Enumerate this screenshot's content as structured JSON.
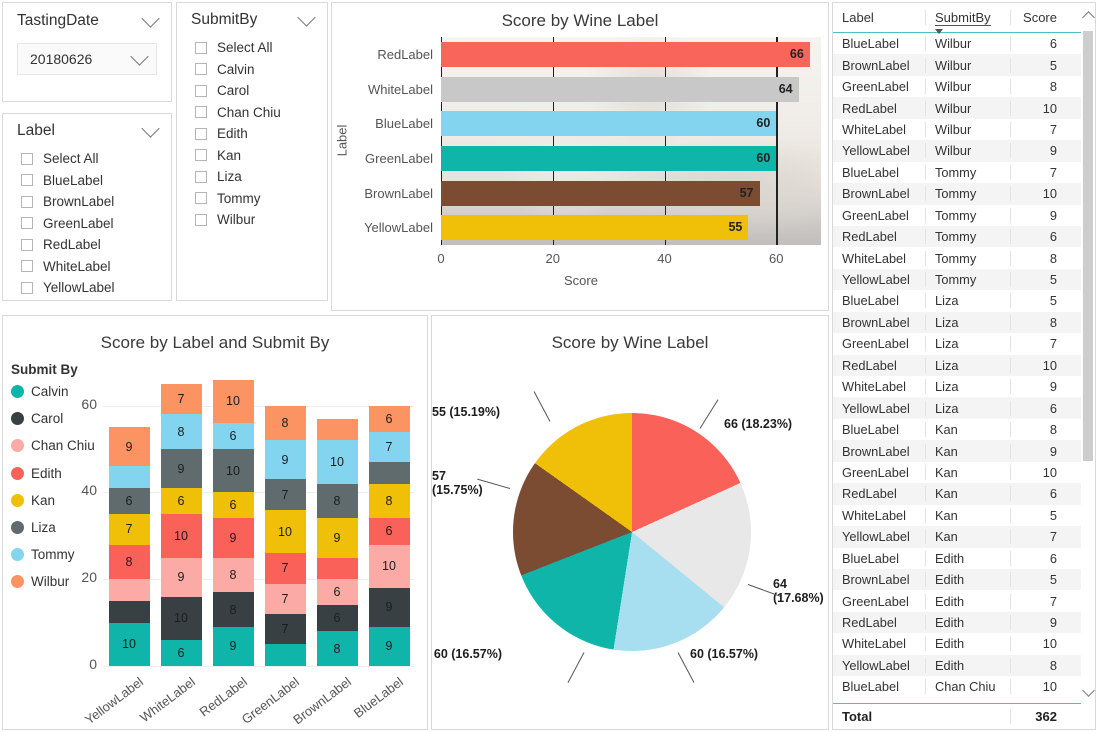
{
  "slicers": {
    "tasting_date": {
      "title": "TastingDate",
      "selected": "20180626"
    },
    "label": {
      "title": "Label",
      "items": [
        "Select All",
        "BlueLabel",
        "BrownLabel",
        "GreenLabel",
        "RedLabel",
        "WhiteLabel",
        "YellowLabel"
      ]
    },
    "submit_by": {
      "title": "SubmitBy",
      "items": [
        "Select All",
        "Calvin",
        "Carol",
        "Chan Chiu",
        "Edith",
        "Kan",
        "Liza",
        "Tommy",
        "Wilbur"
      ]
    }
  },
  "table": {
    "columns": [
      "Label",
      "SubmitBy",
      "Score"
    ],
    "sorted_column": "SubmitBy",
    "rows": [
      [
        "BlueLabel",
        "Wilbur",
        "6"
      ],
      [
        "BrownLabel",
        "Wilbur",
        "5"
      ],
      [
        "GreenLabel",
        "Wilbur",
        "8"
      ],
      [
        "RedLabel",
        "Wilbur",
        "10"
      ],
      [
        "WhiteLabel",
        "Wilbur",
        "7"
      ],
      [
        "YellowLabel",
        "Wilbur",
        "9"
      ],
      [
        "BlueLabel",
        "Tommy",
        "7"
      ],
      [
        "BrownLabel",
        "Tommy",
        "10"
      ],
      [
        "GreenLabel",
        "Tommy",
        "9"
      ],
      [
        "RedLabel",
        "Tommy",
        "6"
      ],
      [
        "WhiteLabel",
        "Tommy",
        "8"
      ],
      [
        "YellowLabel",
        "Tommy",
        "5"
      ],
      [
        "BlueLabel",
        "Liza",
        "5"
      ],
      [
        "BrownLabel",
        "Liza",
        "8"
      ],
      [
        "GreenLabel",
        "Liza",
        "7"
      ],
      [
        "RedLabel",
        "Liza",
        "10"
      ],
      [
        "WhiteLabel",
        "Liza",
        "9"
      ],
      [
        "YellowLabel",
        "Liza",
        "6"
      ],
      [
        "BlueLabel",
        "Kan",
        "8"
      ],
      [
        "BrownLabel",
        "Kan",
        "9"
      ],
      [
        "GreenLabel",
        "Kan",
        "10"
      ],
      [
        "RedLabel",
        "Kan",
        "6"
      ],
      [
        "WhiteLabel",
        "Kan",
        "5"
      ],
      [
        "YellowLabel",
        "Kan",
        "7"
      ],
      [
        "BlueLabel",
        "Edith",
        "6"
      ],
      [
        "BrownLabel",
        "Edith",
        "5"
      ],
      [
        "GreenLabel",
        "Edith",
        "7"
      ],
      [
        "RedLabel",
        "Edith",
        "9"
      ],
      [
        "WhiteLabel",
        "Edith",
        "10"
      ],
      [
        "YellowLabel",
        "Edith",
        "8"
      ],
      [
        "BlueLabel",
        "Chan Chiu",
        "10"
      ]
    ],
    "total_label": "Total",
    "total_value": "362"
  },
  "chart_data": [
    {
      "id": "hbar",
      "type": "bar",
      "orientation": "horizontal",
      "title": "Score by Wine Label",
      "xlabel": "Score",
      "ylabel": "Label",
      "xlim": [
        0,
        68
      ],
      "xticks": [
        "0",
        "20",
        "40",
        "60"
      ],
      "grid": true,
      "categories": [
        "RedLabel",
        "WhiteLabel",
        "BlueLabel",
        "GreenLabel",
        "BrownLabel",
        "YellowLabel"
      ],
      "values": [
        66,
        64,
        60,
        60,
        57,
        55
      ],
      "colors": [
        "#f9655b",
        "#c8c8c8",
        "#83d4ee",
        "#0fb5a8",
        "#7b4b32",
        "#efc007"
      ]
    },
    {
      "id": "stacked",
      "type": "bar",
      "orientation": "vertical",
      "stacked": true,
      "title": "Score by Label and Submit By",
      "legend_title": "Submit By",
      "legend_position": "left",
      "ylim": [
        0,
        68
      ],
      "yticks": [
        "0",
        "20",
        "40",
        "60"
      ],
      "categories": [
        "YellowLabel",
        "WhiteLabel",
        "RedLabel",
        "GreenLabel",
        "BrownLabel",
        "BlueLabel"
      ],
      "series": [
        {
          "name": "Calvin",
          "color": "#0fb5a8",
          "values": [
            10,
            6,
            9,
            5,
            8,
            9
          ]
        },
        {
          "name": "Carol",
          "color": "#384044",
          "values": [
            5,
            10,
            8,
            7,
            6,
            9
          ]
        },
        {
          "name": "Chan Chiu",
          "color": "#fbaaa6",
          "values": [
            5,
            9,
            8,
            7,
            6,
            10
          ]
        },
        {
          "name": "Edith",
          "color": "#fa6158",
          "values": [
            8,
            10,
            9,
            7,
            5,
            6
          ]
        },
        {
          "name": "Kan",
          "color": "#efc007",
          "values": [
            7,
            6,
            6,
            10,
            9,
            8
          ]
        },
        {
          "name": "Liza",
          "color": "#5f6b6d",
          "values": [
            6,
            9,
            10,
            7,
            8,
            5
          ]
        },
        {
          "name": "Tommy",
          "color": "#83d4ee",
          "values": [
            5,
            8,
            6,
            9,
            10,
            7
          ]
        },
        {
          "name": "Wilbur",
          "color": "#fc9362",
          "values": [
            9,
            7,
            10,
            8,
            5,
            6
          ]
        }
      ],
      "hidden_labels": [
        [
          false,
          true,
          true,
          false,
          false,
          false,
          true,
          false
        ],
        [
          false,
          false,
          false,
          false,
          false,
          false,
          false,
          false
        ],
        [
          false,
          false,
          false,
          false,
          false,
          false,
          false,
          false
        ],
        [
          true,
          false,
          false,
          false,
          false,
          false,
          false,
          false
        ],
        [
          false,
          false,
          false,
          true,
          false,
          false,
          false,
          true
        ],
        [
          false,
          false,
          false,
          false,
          false,
          true,
          false,
          false
        ]
      ]
    },
    {
      "id": "pie",
      "type": "pie",
      "title": "Score by Wine Label",
      "labels": [
        "RedLabel",
        "WhiteLabel",
        "BlueLabel",
        "GreenLabel",
        "BrownLabel",
        "YellowLabel"
      ],
      "values": [
        66,
        64,
        60,
        60,
        57,
        55
      ],
      "percents": [
        "18.23%",
        "17.68%",
        "16.57%",
        "16.57%",
        "15.75%",
        "15.19%"
      ],
      "data_labels": [
        "66 (18.23%)",
        "64\n(17.68%)",
        "60 (16.57%)",
        "60 (16.57%)",
        "57\n(15.75%)",
        "55 (15.19%)"
      ],
      "colors": [
        "#fa6158",
        "#e8e8e8",
        "#a8dff0",
        "#0fb5a8",
        "#7b4b32",
        "#efc007"
      ],
      "total": 362
    }
  ]
}
